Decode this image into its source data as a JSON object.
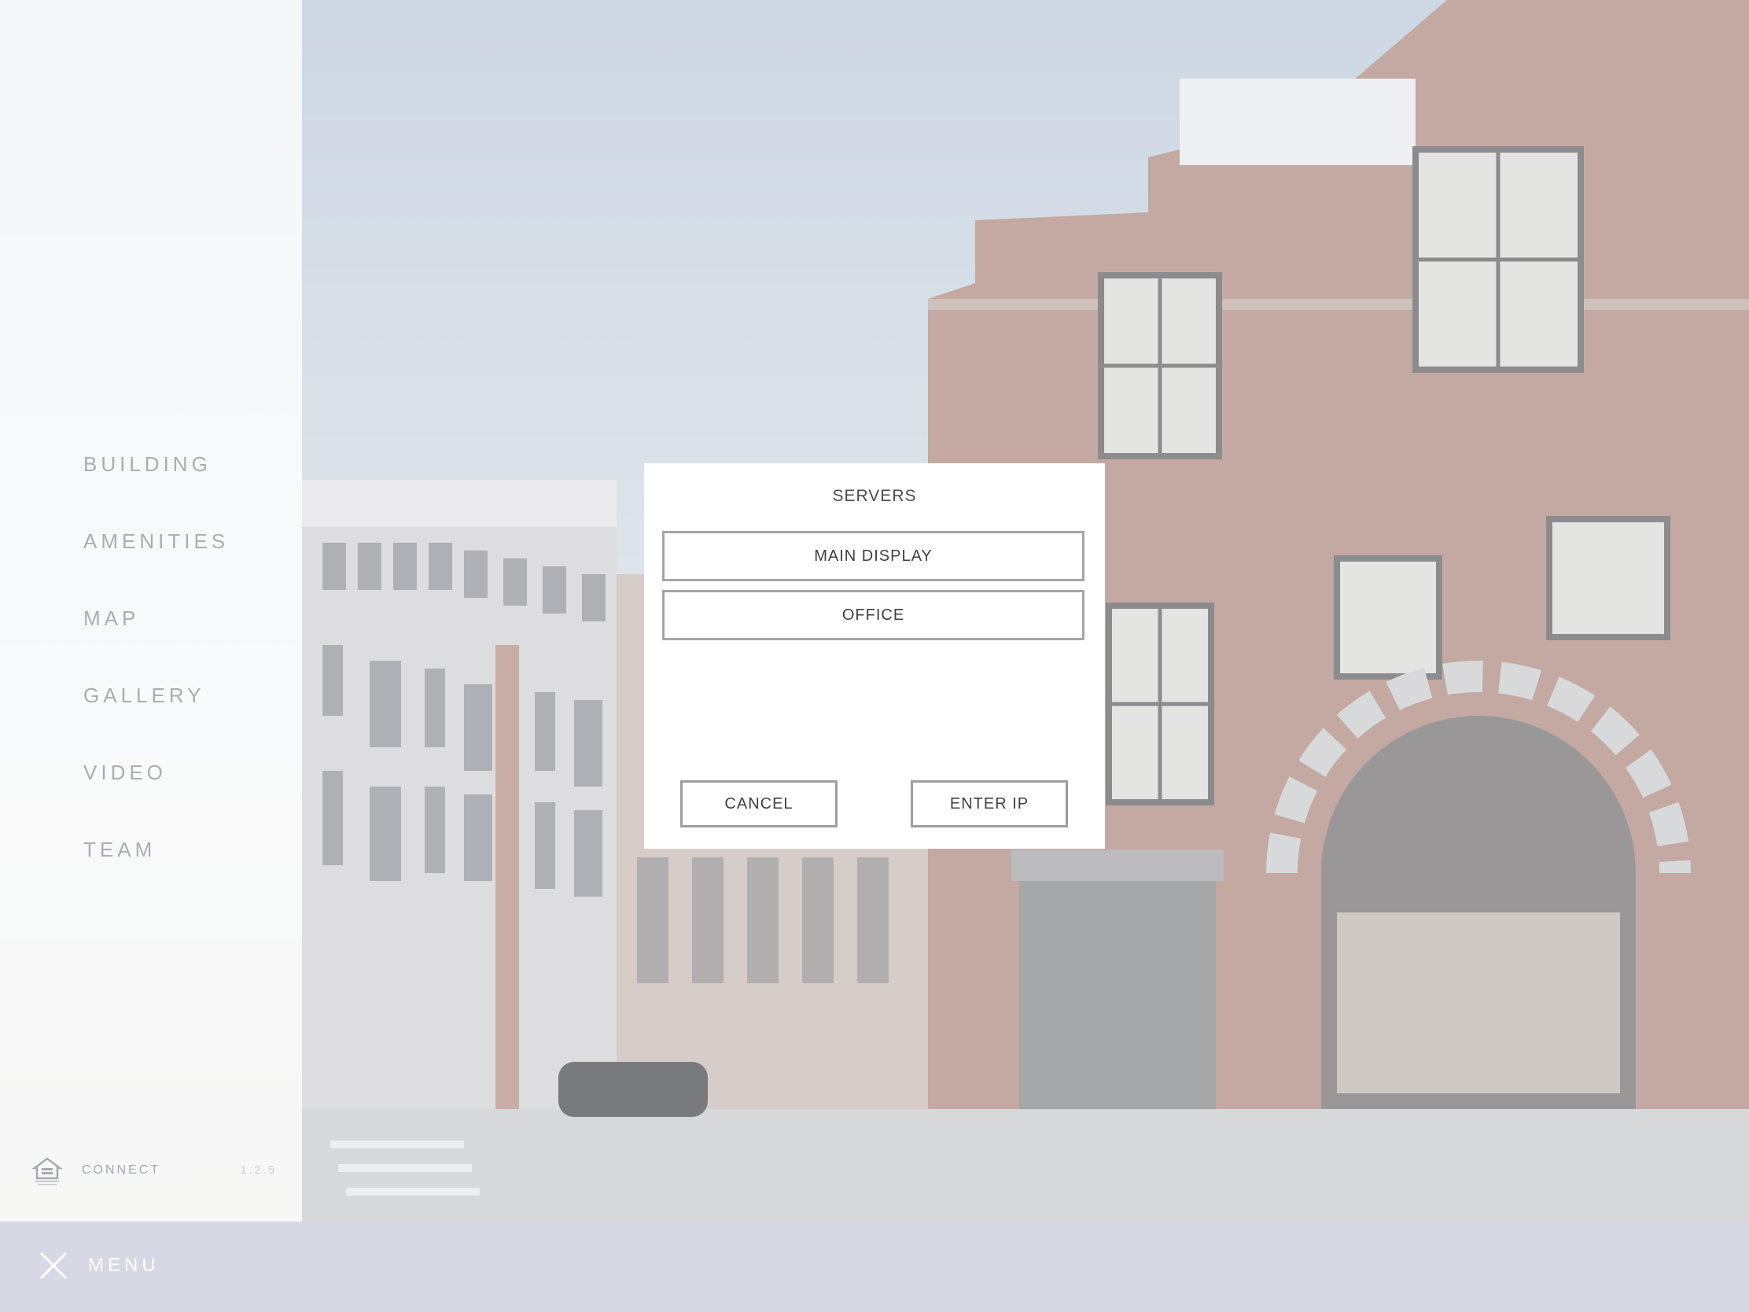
{
  "sidebar": {
    "nav": [
      "BUILDING",
      "AMENITIES",
      "MAP",
      "GALLERY",
      "VIDEO",
      "TEAM"
    ],
    "connect_label": "CONNECT",
    "version": "1.2.5",
    "housing_icon": "equal-housing-opportunity-icon"
  },
  "bottom_bar": {
    "menu_label": "MENU",
    "close_icon": "close-icon"
  },
  "modal": {
    "title": "SERVERS",
    "servers": [
      "MAIN DISPLAY",
      "OFFICE"
    ],
    "cancel_label": "CANCEL",
    "enter_ip_label": "ENTER IP"
  },
  "colors": {
    "sidebar_bg": "#ffffff",
    "nav_text": "#a9adb6",
    "bottom_bar_bg": "#d6d9e4",
    "modal_bg": "#ffffff",
    "button_border": "#a5a5a5",
    "brick": "#a9857a"
  }
}
